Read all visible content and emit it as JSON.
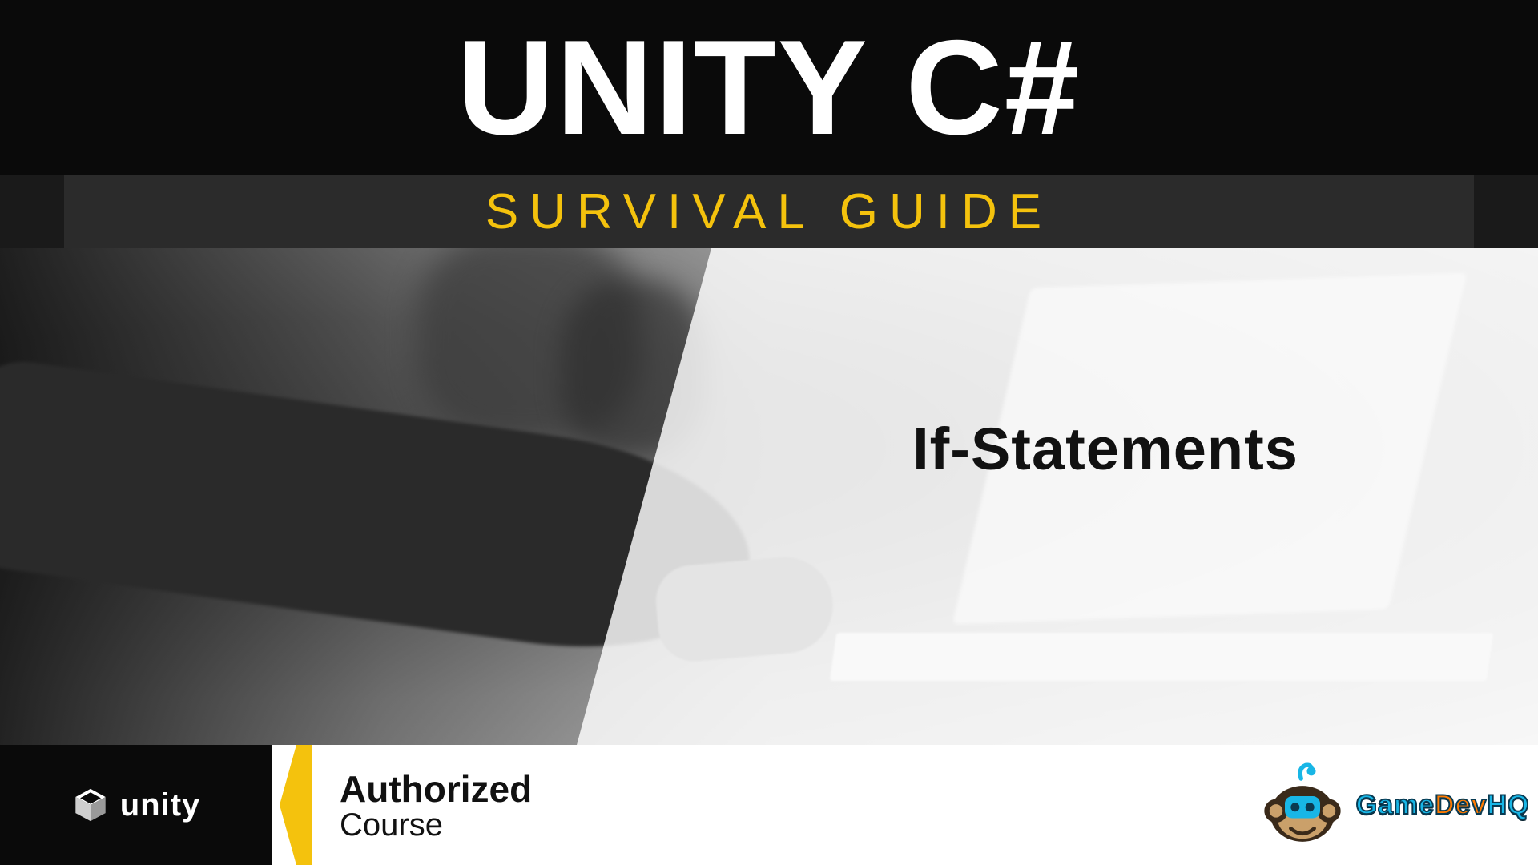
{
  "header": {
    "title": "UNITY C#",
    "subtitle": "SURVIVAL  GUIDE"
  },
  "topic": "If-Statements",
  "footer": {
    "unity_label": "unity",
    "authorized": "Authorized",
    "course": "Course",
    "brand_game": "Game",
    "brand_dev": "Dev",
    "brand_hq": "HQ"
  },
  "colors": {
    "accent_yellow": "#f4c20d",
    "brand_cyan": "#18b6e6",
    "brand_orange": "#ff7a00"
  }
}
